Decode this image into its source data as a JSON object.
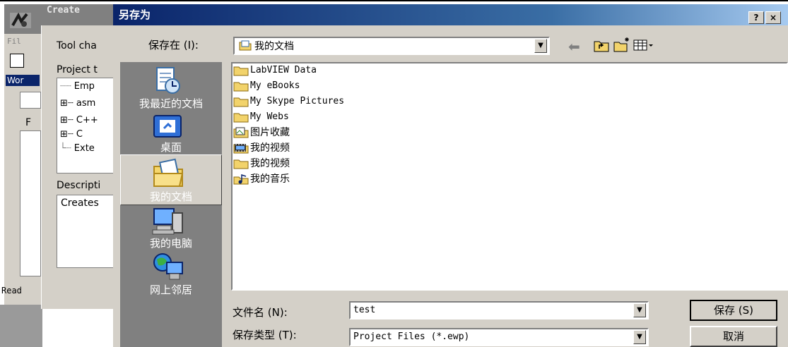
{
  "background_app": {
    "file_menu": "Fil",
    "workspace_label": "Wor",
    "list_header": "F",
    "status": "Read"
  },
  "create_project": {
    "title": "Create",
    "tool_chain_label": "Tool cha",
    "project_templates_label": "Project t",
    "tree": [
      {
        "prefix": "",
        "label": "Emp"
      },
      {
        "prefix": "⊞",
        "label": "asm"
      },
      {
        "prefix": "⊞",
        "label": "C++"
      },
      {
        "prefix": "⊞",
        "label": "C"
      },
      {
        "prefix": "",
        "label": "Exte"
      }
    ],
    "description_label": "Descripti",
    "description_text": "Creates"
  },
  "save_as": {
    "title": "另存为",
    "help_label": "?",
    "close_label": "×",
    "save_in_label": "保存在 (I):",
    "save_in_value": "我的文档",
    "places": [
      {
        "label": "我最近的文档",
        "icon": "recent-documents-icon"
      },
      {
        "label": "桌面",
        "icon": "desktop-icon"
      },
      {
        "label": "我的文档",
        "icon": "my-documents-icon",
        "selected": true
      },
      {
        "label": "我的电脑",
        "icon": "my-computer-icon"
      },
      {
        "label": "网上邻居",
        "icon": "network-places-icon"
      }
    ],
    "files": [
      {
        "name": "LabVIEW Data",
        "icon": "folder-icon"
      },
      {
        "name": "My eBooks",
        "icon": "folder-icon"
      },
      {
        "name": "My Skype Pictures",
        "icon": "folder-icon"
      },
      {
        "name": "My Webs",
        "icon": "folder-icon"
      },
      {
        "name": "图片收藏",
        "icon": "pictures-folder-icon"
      },
      {
        "name": "我的视频",
        "icon": "video-folder-icon"
      },
      {
        "name": "我的视频",
        "icon": "folder-icon"
      },
      {
        "name": "我的音乐",
        "icon": "music-folder-icon"
      }
    ],
    "filename_label": "文件名 (N):",
    "filename_value": "test",
    "filetype_label": "保存类型 (T):",
    "filetype_value": "Project Files (*.ewp)",
    "save_button": "保存 (S)",
    "cancel_button": "取消"
  }
}
